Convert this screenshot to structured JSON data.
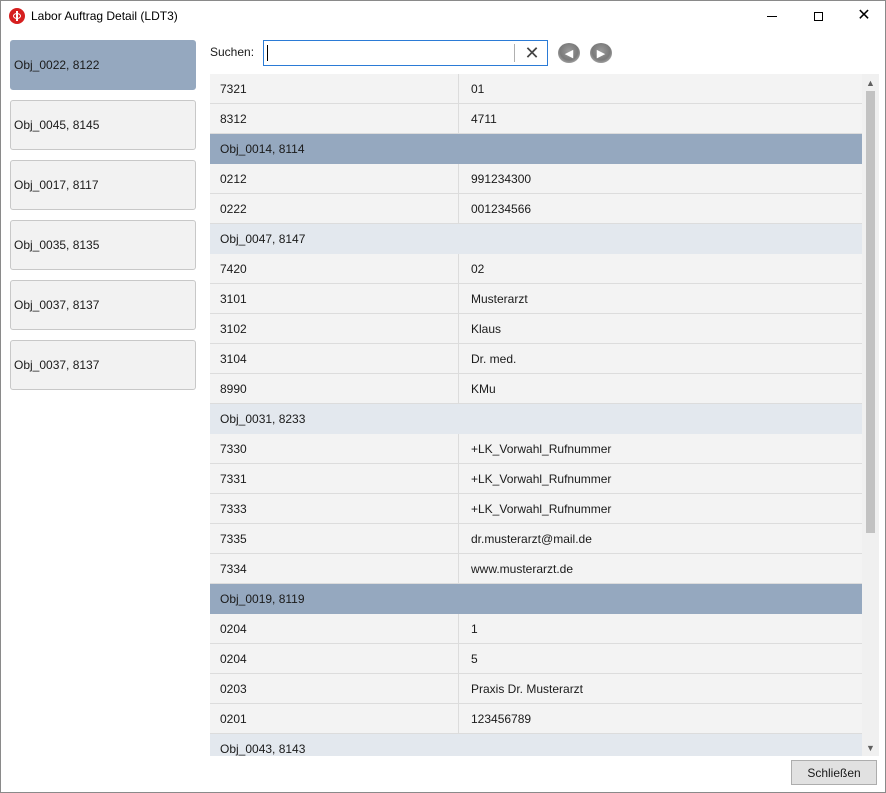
{
  "window": {
    "title": "Labor Auftrag Detail (LDT3)",
    "minimize_glyph": "",
    "close_glyph": "✕"
  },
  "sidebar": {
    "items": [
      {
        "label": "Obj_0022, 8122",
        "selected": true
      },
      {
        "label": "Obj_0045, 8145",
        "selected": false
      },
      {
        "label": "Obj_0017, 8117",
        "selected": false
      },
      {
        "label": "Obj_0035, 8135",
        "selected": false
      },
      {
        "label": "Obj_0037, 8137",
        "selected": false
      },
      {
        "label": "Obj_0037, 8137",
        "selected": false
      }
    ]
  },
  "search": {
    "label": "Suchen:",
    "value": "",
    "clear_glyph": "✕",
    "prev_glyph": "◀",
    "next_glyph": "▶"
  },
  "grid": {
    "rows": [
      {
        "type": "field",
        "key": "7321",
        "value": "01"
      },
      {
        "type": "field",
        "key": "8312",
        "value": "4711"
      },
      {
        "type": "group",
        "style": "dark",
        "label": "Obj_0014, 8114"
      },
      {
        "type": "field",
        "key": "0212",
        "value": "991234300"
      },
      {
        "type": "field",
        "key": "0222",
        "value": "001234566"
      },
      {
        "type": "group",
        "style": "light",
        "label": "Obj_0047, 8147"
      },
      {
        "type": "field",
        "key": "7420",
        "value": "02"
      },
      {
        "type": "field",
        "key": "3101",
        "value": "Musterarzt"
      },
      {
        "type": "field",
        "key": "3102",
        "value": "Klaus"
      },
      {
        "type": "field",
        "key": "3104",
        "value": "Dr. med."
      },
      {
        "type": "field",
        "key": "8990",
        "value": "KMu"
      },
      {
        "type": "group",
        "style": "light",
        "label": "Obj_0031, 8233"
      },
      {
        "type": "field",
        "key": "7330",
        "value": "+LK_Vorwahl_Rufnummer"
      },
      {
        "type": "field",
        "key": "7331",
        "value": "+LK_Vorwahl_Rufnummer"
      },
      {
        "type": "field",
        "key": "7333",
        "value": "+LK_Vorwahl_Rufnummer"
      },
      {
        "type": "field",
        "key": "7335",
        "value": "dr.musterarzt@mail.de"
      },
      {
        "type": "field",
        "key": "7334",
        "value": "www.musterarzt.de"
      },
      {
        "type": "group",
        "style": "dark",
        "label": "Obj_0019, 8119"
      },
      {
        "type": "field",
        "key": "0204",
        "value": "1"
      },
      {
        "type": "field",
        "key": "0204",
        "value": "5"
      },
      {
        "type": "field",
        "key": "0203",
        "value": "Praxis Dr. Musterarzt"
      },
      {
        "type": "field",
        "key": "0201",
        "value": "123456789"
      },
      {
        "type": "group",
        "style": "light",
        "label": "Obj_0043, 8143"
      }
    ]
  },
  "scrollbar": {
    "up_glyph": "▲",
    "down_glyph": "▼"
  },
  "footer": {
    "close_label": "Schließen"
  },
  "colors": {
    "selected_bg": "#95a8bf",
    "group_light_bg": "#e3e8ee",
    "row_bg": "#f3f3f3",
    "search_border": "#2b7bd6",
    "app_icon": "#d61f1f"
  }
}
